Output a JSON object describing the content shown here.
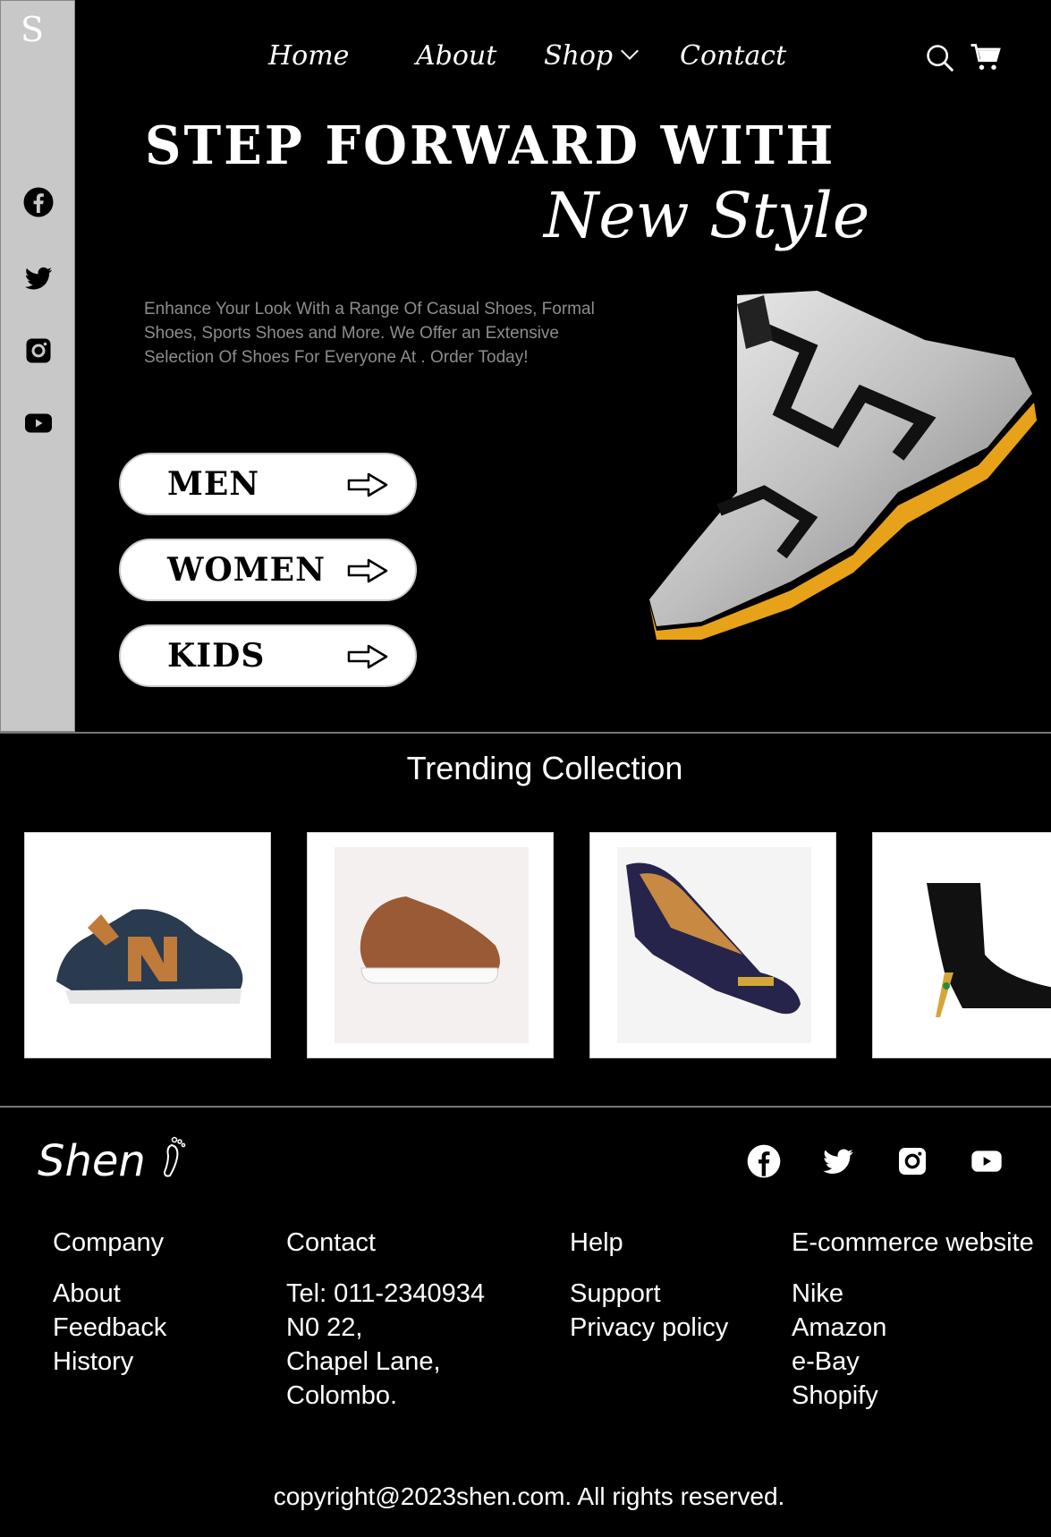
{
  "sidebar": {
    "logo": "S",
    "social": [
      "facebook-icon",
      "twitter-icon",
      "instagram-icon",
      "youtube-icon"
    ]
  },
  "nav": {
    "home": "Home",
    "about": "About",
    "shop": "Shop",
    "contact": "Contact"
  },
  "hero": {
    "headline": "STEP FORWARD WITH",
    "subheadline": "New Style",
    "description": "Enhance Your Look With a Range Of Casual Shoes, Formal Shoes, Sports Shoes and More. We Offer an Extensive Selection Of Shoes For Everyone At  . Order Today!",
    "categories": [
      "MEN",
      "WOMEN",
      "KIDS"
    ]
  },
  "trending": {
    "title": "Trending Collection",
    "items": [
      "sneaker-navy",
      "sneaker-brown-leather",
      "wedge-pump-navy",
      "ankle-boot-black"
    ]
  },
  "footer": {
    "brand": "Shen",
    "columns": [
      {
        "heading": "Company",
        "items": [
          "About",
          "Feedback",
          "History"
        ]
      },
      {
        "heading": "Contact",
        "items": [
          "Tel: 011-2340934",
          "N0 22,",
          "Chapel Lane,",
          "Colombo."
        ]
      },
      {
        "heading": "Help",
        "items": [
          "Support",
          "Privacy policy"
        ]
      },
      {
        "heading": "E-commerce website",
        "items": [
          "Nike",
          "Amazon",
          "e-Bay",
          "Shopify"
        ]
      }
    ],
    "copyright": "copyright@2023shen.com. All rights reserved."
  },
  "colors": {
    "background": "#000000",
    "sidebar": "#c8c8c8",
    "description_text": "#8d8d8d",
    "accent_orange": "#e8a21a"
  }
}
